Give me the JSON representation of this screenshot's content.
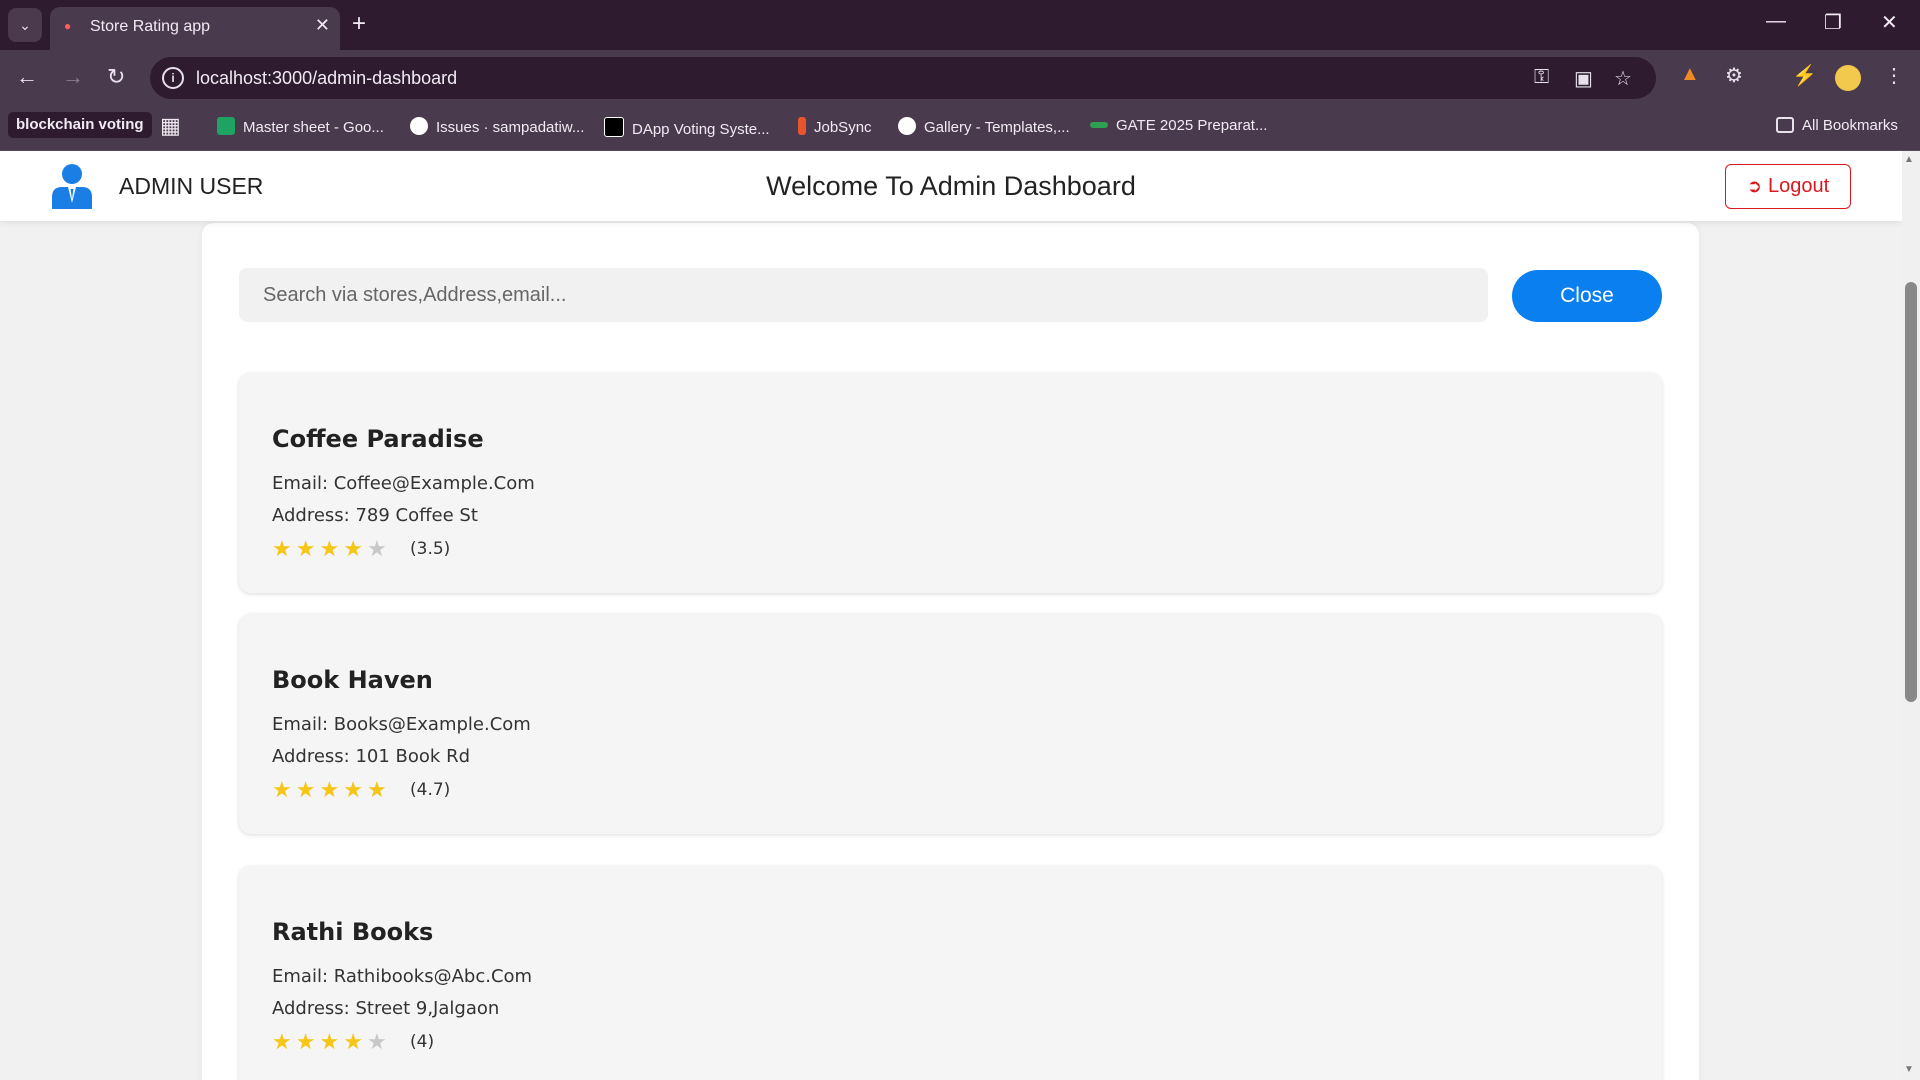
{
  "browser": {
    "tab_title": "Store Rating app",
    "url": "localhost:3000/admin-dashboard",
    "bookmarks": [
      {
        "label": "blockchain voting",
        "icon": "folder-chip"
      },
      {
        "label": "Master sheet - Goo...",
        "icon": "sheets-icon",
        "color": "#1ea362"
      },
      {
        "label": "Issues · sampadatiw...",
        "icon": "github-icon",
        "color": "#ffffff"
      },
      {
        "label": "DApp Voting Syste...",
        "icon": "medium-icon",
        "color": "#000000"
      },
      {
        "label": "JobSync",
        "icon": "jobsync-icon",
        "color": "#e8542b"
      },
      {
        "label": "Gallery - Templates,...",
        "icon": "gallery-icon",
        "color": "#ffffff"
      },
      {
        "label": "GATE 2025 Preparat...",
        "icon": "gate-icon",
        "color": "#2ea04f"
      }
    ],
    "all_bookmarks": "All Bookmarks"
  },
  "header": {
    "user_label": "ADMIN USER",
    "title": "Welcome To Admin Dashboard",
    "logout_label": "Logout"
  },
  "search": {
    "placeholder": "Search via stores,Address,email...",
    "close_label": "Close"
  },
  "stores": [
    {
      "name": "Coffee Paradise",
      "email": "Email: Coffee@Example.Com",
      "address": "Address: 789 Coffee St",
      "stars": 4,
      "rating_text": "(3.5)"
    },
    {
      "name": "Book Haven",
      "email": "Email: Books@Example.Com",
      "address": "Address: 101 Book Rd",
      "stars": 5,
      "rating_text": "(4.7)"
    },
    {
      "name": "Rathi Books",
      "email": "Email: Rathibooks@Abc.Com",
      "address": "Address: Street 9,Jalgaon",
      "stars": 4,
      "rating_text": "(4)"
    }
  ],
  "colors": {
    "accent": "#0a7ff0",
    "logout": "#d9191e",
    "star": "#f5c518"
  }
}
